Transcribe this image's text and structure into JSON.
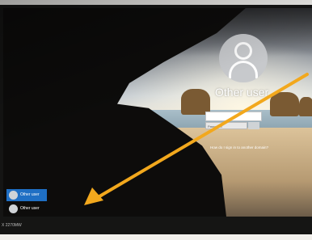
{
  "lock_screen": {
    "username": "Other user",
    "password_placeholder": "Password",
    "help_link": "How do I sign in to another domain?"
  },
  "user_list": [
    {
      "label": "Other user",
      "selected": true
    },
    {
      "label": "Other user",
      "selected": false
    }
  ],
  "monitor": {
    "model_label": "X 2270MW"
  },
  "annotation": {
    "arrow_color": "#f2a81d"
  }
}
